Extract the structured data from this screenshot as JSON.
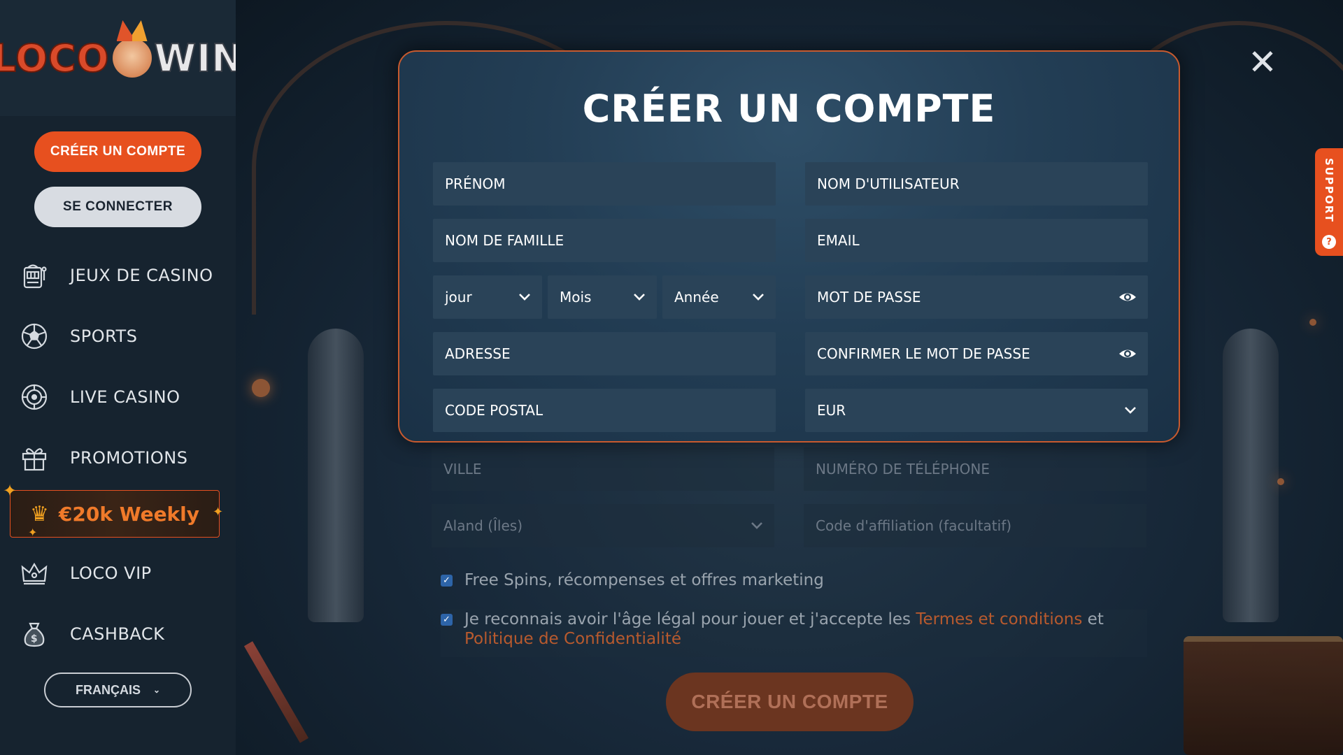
{
  "logo": {
    "part1": "LOCO",
    "part2": "WIN"
  },
  "sidebar": {
    "create_account": "CRÉER UN COMPTE",
    "login": "SE CONNECTER",
    "items": [
      {
        "label": "JEUX DE CASINO",
        "icon": "slot-machine-icon"
      },
      {
        "label": "SPORTS",
        "icon": "soccer-ball-icon"
      },
      {
        "label": "LIVE CASINO",
        "icon": "roulette-icon"
      },
      {
        "label": "PROMOTIONS",
        "icon": "gift-icon"
      }
    ],
    "weekly_banner": "€20k Weekly",
    "items_after": [
      {
        "label": "LOCO VIP",
        "icon": "crown-icon"
      },
      {
        "label": "CASHBACK",
        "icon": "money-bag-icon"
      }
    ],
    "language": "FRANÇAIS"
  },
  "support": {
    "label": "SUPPORT"
  },
  "modal": {
    "title": "CRÉER UN COMPTE",
    "fields": {
      "first_name": "PRÉNOM",
      "username": "NOM D'UTILISATEUR",
      "last_name": "NOM DE FAMILLE",
      "email": "EMAIL",
      "day": "jour",
      "month": "Mois",
      "year": "Année",
      "password": "MOT DE PASSE",
      "address": "ADRESSE",
      "confirm_password": "CONFIRMER LE MOT DE PASSE",
      "postal_code": "CODE POSTAL",
      "currency": "EUR"
    }
  },
  "form_below": {
    "city": "VILLE",
    "phone": "NUMÉRO DE TÉLÉPHONE",
    "country": "Aland (Îles)",
    "affiliate": "Code d'affiliation (facultatif)",
    "marketing_consent": "Free Spins, récompenses et offres marketing",
    "terms_prefix": "Je reconnais avoir l'âge légal pour jouer et j'accepte les",
    "terms_link": "Termes et conditions",
    "terms_and": "et",
    "privacy_link": "Politique de Confidentialité",
    "submit": "CRÉER UN COMPTE"
  }
}
